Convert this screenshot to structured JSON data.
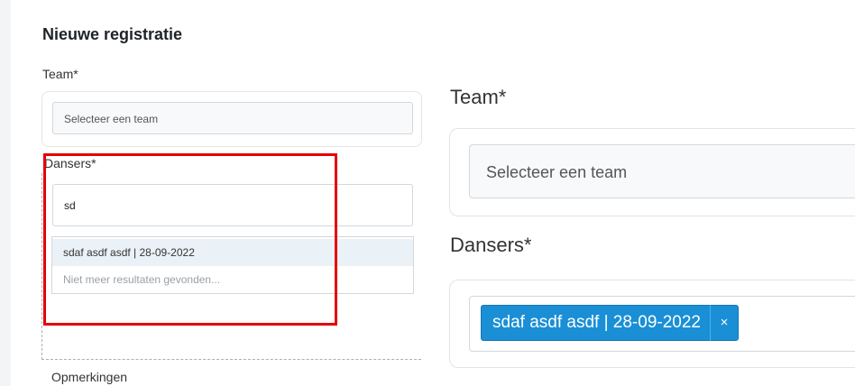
{
  "form": {
    "title": "Nieuwe registratie",
    "team_label": "Team*",
    "team_placeholder": "Selecteer een team",
    "dansers_label": "Dansers*",
    "search_value": "sd",
    "dropdown": {
      "option": "sdaf asdf asdf | 28-09-2022",
      "no_more": "Niet meer resultaten gevonden..."
    },
    "remarks_label": "Opmerkingen"
  },
  "zoom": {
    "team_label": "Team*",
    "team_placeholder": "Selecteer een team",
    "dansers_label": "Dansers*",
    "selected_chip": "sdaf asdf asdf | 28-09-2022",
    "chip_remove": "×"
  },
  "colors": {
    "highlight_border": "#e60000",
    "chip_bg": "#1a8fd6",
    "option_hover_bg": "#eaf2f8"
  }
}
